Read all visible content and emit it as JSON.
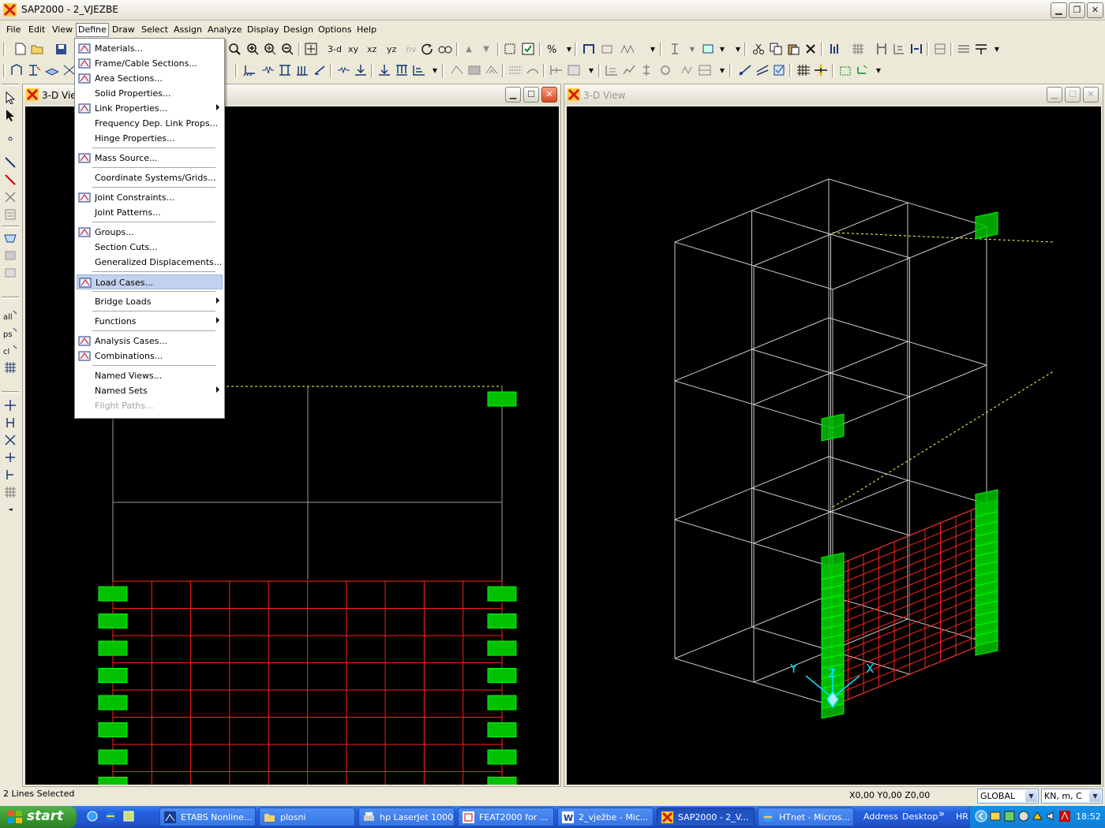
{
  "window": {
    "title": "SAP2000 - 2_VJEZBE"
  },
  "menubar": [
    "File",
    "Edit",
    "View",
    "Define",
    "Draw",
    "Select",
    "Assign",
    "Analyze",
    "Display",
    "Design",
    "Options",
    "Help"
  ],
  "toolbar": {
    "btn_3d": "3-d",
    "btn_xy": "xy",
    "btn_xz": "xz",
    "btn_yz": "yz",
    "btn_nv": "nv"
  },
  "define_menu": [
    {
      "label": "Materials...",
      "icon": "materials-icon",
      "submenu": false
    },
    {
      "label": "Frame/Cable Sections...",
      "icon": "frame-section-icon",
      "submenu": false
    },
    {
      "label": "Area Sections...",
      "icon": "area-section-icon",
      "submenu": false
    },
    {
      "label": "Solid Properties...",
      "icon": "",
      "submenu": false
    },
    {
      "label": "Link Properties...",
      "icon": "link-icon",
      "submenu": true
    },
    {
      "label": "Frequency Dep. Link Props...",
      "icon": "",
      "submenu": false
    },
    {
      "label": "Hinge Properties...",
      "icon": "",
      "submenu": false
    },
    {
      "label": "Mass Source...",
      "icon": "mass-icon",
      "submenu": false
    },
    {
      "label": "Coordinate Systems/Grids...",
      "icon": "",
      "submenu": false
    },
    {
      "label": "Joint Constraints...",
      "icon": "constraint-icon",
      "submenu": false
    },
    {
      "label": "Joint Patterns...",
      "icon": "",
      "submenu": false
    },
    {
      "label": "Groups...",
      "icon": "groups-icon",
      "submenu": false
    },
    {
      "label": "Section Cuts...",
      "icon": "",
      "submenu": false
    },
    {
      "label": "Generalized Displacements...",
      "icon": "",
      "submenu": false
    },
    {
      "label": "Load Cases...",
      "icon": "load-cases-icon",
      "submenu": false,
      "selected": true
    },
    {
      "label": "Bridge Loads",
      "icon": "",
      "submenu": true
    },
    {
      "label": "Functions",
      "icon": "",
      "submenu": true
    },
    {
      "label": "Analysis Cases...",
      "icon": "analysis-cases-icon",
      "submenu": false
    },
    {
      "label": "Combinations...",
      "icon": "combinations-icon",
      "submenu": false
    },
    {
      "label": "Named Views...",
      "icon": "",
      "submenu": false
    },
    {
      "label": "Named Sets",
      "icon": "",
      "submenu": true
    },
    {
      "label": "Flight Paths...",
      "icon": "",
      "submenu": false,
      "disabled": true
    }
  ],
  "views": {
    "left": {
      "title": "3-D View"
    },
    "right": {
      "title": "3-D View"
    },
    "axes": {
      "x": "X",
      "y": "Y",
      "z": "Z"
    }
  },
  "status": {
    "message": "2 Lines Selected",
    "coords": "X0,00  Y0,00  Z0,00",
    "coord_system": "GLOBAL",
    "units": "KN, m, C"
  },
  "taskbar": {
    "start": "start",
    "tasks": [
      {
        "label": "ETABS Nonline...",
        "active": false
      },
      {
        "label": "plosni",
        "active": false
      },
      {
        "label": "hp LaserJet 1000",
        "active": false
      },
      {
        "label": "FEAT2000 for ...",
        "active": false
      },
      {
        "label": "2_vježbe - Mic...",
        "active": false
      },
      {
        "label": "SAP2000 - 2_V...",
        "active": true
      },
      {
        "label": "HTnet - Micros...",
        "active": false
      }
    ],
    "address": "Address",
    "desktop": "Desktop",
    "lang": "HR",
    "clock": "18:52"
  },
  "colors": {
    "accent": "#316ac5",
    "mesh": "#ff2020",
    "restraint": "#00e000",
    "grid": "#c8c8c8",
    "axis": "#00e5ff"
  }
}
